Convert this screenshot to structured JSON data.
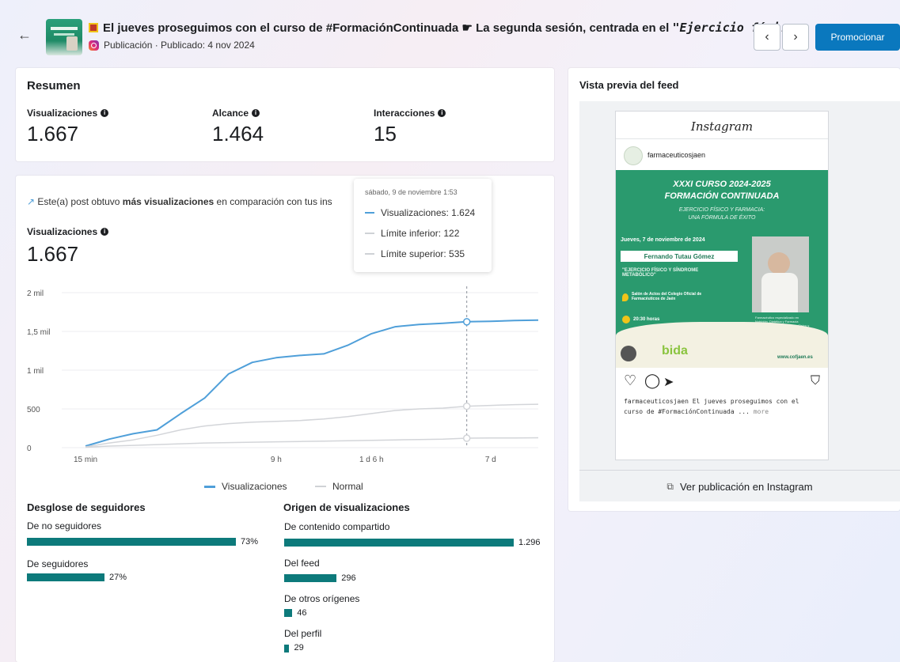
{
  "header": {
    "back_icon": "arrow-left-icon",
    "title_text": "El jueves proseguimos con el curso de #FormaciónContinuada",
    "title_italic": "\"Ejercicio físi...",
    "title_mid": " La segunda sesión, centrada en el ",
    "subtitle": "Publicación · Publicado: 4 nov 2024",
    "prev_icon": "chevron-left-icon",
    "next_icon": "chevron-right-icon",
    "promote_label": "Promocionar"
  },
  "summary": {
    "title": "Resumen",
    "metrics": [
      {
        "label": "Visualizaciones",
        "value": "1.667"
      },
      {
        "label": "Alcance",
        "value": "1.464"
      },
      {
        "label": "Interacciones",
        "value": "15"
      }
    ]
  },
  "views_chart": {
    "insight_prefix": "Este(a) post obtuvo ",
    "insight_bold": "más visualizaciones",
    "insight_suffix": " en comparación con tus ins",
    "label": "Visualizaciones",
    "value": "1.667",
    "tooltip": {
      "date": "sábado, 9 de noviembre 1:53",
      "rows": [
        "Visualizaciones: 1.624",
        "Límite inferior: 122",
        "Límite superior: 535"
      ]
    },
    "legend": [
      "Visualizaciones",
      "Normal"
    ],
    "colors": {
      "views": "#4f9fd9",
      "normal": "#d3d5d9"
    }
  },
  "chart_data": {
    "type": "line",
    "x": [
      "15 min",
      "2 h",
      "3 h",
      "4 h",
      "5 h",
      "6 h",
      "7 h",
      "8 h",
      "9 h",
      "12 h",
      "18 h",
      "1 d",
      "1 d 6 h",
      "2 d",
      "4 d",
      "5 d",
      "6 d",
      "7 d",
      "8 d",
      "9 d"
    ],
    "x_ticks": [
      "15 min",
      "9 h",
      "1 d 6 h",
      "7 d"
    ],
    "y_ticks": [
      "0",
      "500",
      "1 mil",
      "1,5 mil",
      "2 mil"
    ],
    "ylim": [
      0,
      2000
    ],
    "series": [
      {
        "name": "Visualizaciones",
        "values": [
          20,
          110,
          180,
          230,
          440,
          640,
          950,
          1100,
          1160,
          1190,
          1210,
          1320,
          1470,
          1560,
          1590,
          1605,
          1624,
          1630,
          1640,
          1645
        ]
      },
      {
        "name": "Normal",
        "values": [
          10,
          60,
          100,
          160,
          230,
          280,
          310,
          330,
          340,
          350,
          370,
          400,
          440,
          480,
          500,
          510,
          535,
          545,
          555,
          560
        ]
      },
      {
        "name": "Límite inferior",
        "values": [
          5,
          20,
          30,
          40,
          50,
          60,
          65,
          70,
          75,
          80,
          85,
          90,
          95,
          100,
          105,
          110,
          122,
          124,
          126,
          128
        ]
      }
    ]
  },
  "followers": {
    "title": "Desglose de seguidores",
    "items": [
      {
        "label": "De no seguidores",
        "pct": 73,
        "value": "73%"
      },
      {
        "label": "De seguidores",
        "pct": 27,
        "value": "27%"
      }
    ]
  },
  "origins": {
    "title": "Origen de visualizaciones",
    "items": [
      {
        "label": "De contenido compartido",
        "count": 1296,
        "value": "1.296"
      },
      {
        "label": "Del feed",
        "count": 296,
        "value": "296"
      },
      {
        "label": "De otros orígenes",
        "count": 46,
        "value": "46"
      },
      {
        "label": "Del perfil",
        "count": 29,
        "value": "29"
      }
    ]
  },
  "preview": {
    "title": "Vista previa del feed",
    "ig_logo": "Instagram",
    "account": "farmaceuticosjaen",
    "poster": {
      "title1": "XXXI CURSO 2024-2025",
      "title2": "FORMACIÓN CONTINUADA",
      "subtitle1": "EJERCICIO FÍSICO Y FARMACIA:",
      "subtitle2": "UNA FÓRMULA DE ÉXITO",
      "date": "Jueves, 7 de noviembre de 2024",
      "speaker": "Fernando Tutau Gómez",
      "topic": "\"EJERCICIO FÍSICO Y SÍNDROME METABÓLICO\"",
      "venue": "Salón de Actos del Colegio Oficial de Farmacéuticos de Jaén",
      "time": "20:30 horas",
      "bio": "Farmacéutico especializado en Nutrición, Dietética y Farmacia Deportiva. Máster en Ejercicio Físico y Salud.",
      "url": "www.cofjaen.es",
      "sponsor": "bida"
    },
    "caption_account": "farmaceuticosjaen",
    "caption_text": " El jueves proseguimos con el curso de #FormaciónContinuada ...",
    "caption_more": "more",
    "view_link": "Ver publicación en Instagram"
  }
}
